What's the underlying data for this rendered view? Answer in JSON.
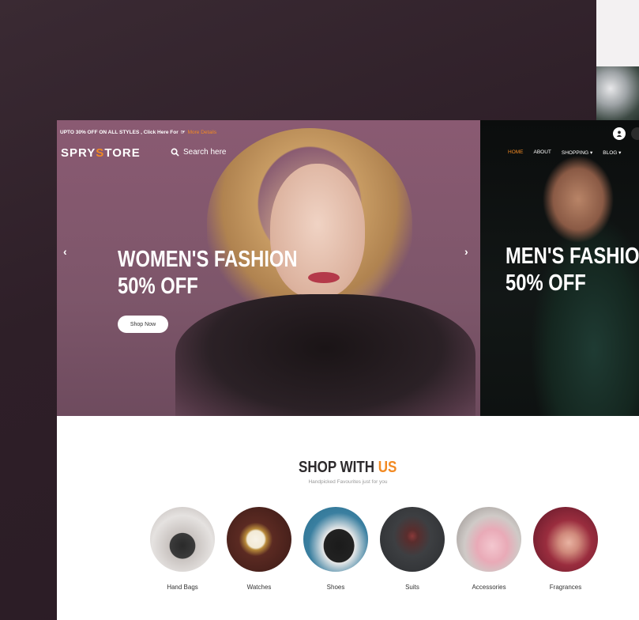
{
  "promo": {
    "text": "UPTO 30% OFF ON ALL STYLES ,  Click Here For",
    "link": "More Details"
  },
  "brand": {
    "part1": "SPRY",
    "part2": "S",
    "part3": "TORE"
  },
  "search": {
    "placeholder": "Search here"
  },
  "nav": [
    {
      "label": "HOME"
    },
    {
      "label": "ABOUT"
    },
    {
      "label": "SHOPPING ▾"
    },
    {
      "label": "BLOG ▾"
    }
  ],
  "hero": {
    "slide1": {
      "line1": "WOMEN'S FASHION",
      "line2": "50% OFF",
      "button": "Shop Now"
    },
    "slide2": {
      "line1": "MEN'S FASHION",
      "line2": "50% OFF"
    }
  },
  "section": {
    "title_a": "SHOP WITH ",
    "title_b": "US",
    "subtitle": "Handpicked Favourites just for you"
  },
  "categories": [
    {
      "label": "Hand Bags"
    },
    {
      "label": "Watches"
    },
    {
      "label": "Shoes"
    },
    {
      "label": "Suits"
    },
    {
      "label": "Accessories"
    },
    {
      "label": "Fragrances"
    }
  ],
  "colors": {
    "accent": "#f28a23",
    "dark": "#2d2a2c"
  }
}
